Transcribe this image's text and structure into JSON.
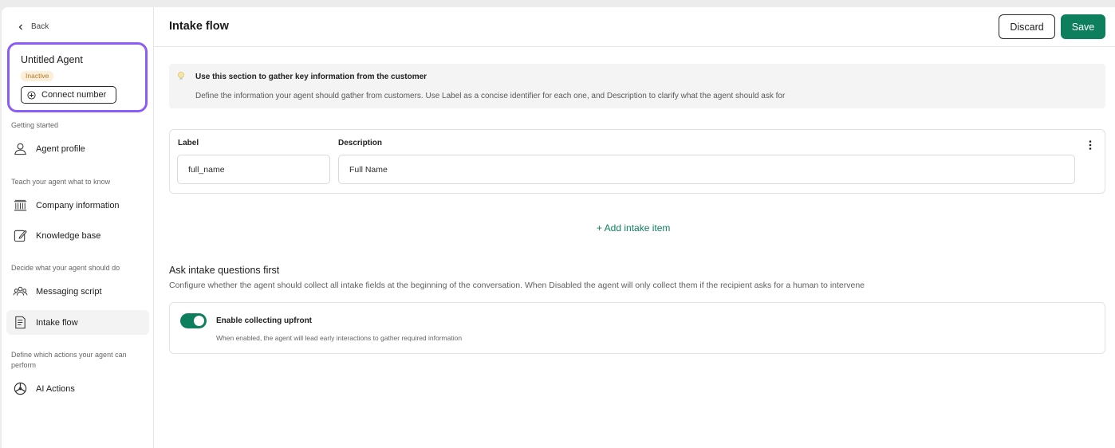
{
  "sidebar": {
    "back_label": "Back",
    "agent": {
      "name": "Untitled Agent",
      "status": "Inactive",
      "connect_label": "Connect number"
    },
    "sections": [
      {
        "heading": "Getting started"
      },
      {
        "heading": "Teach your agent what to know"
      },
      {
        "heading": "Decide what your agent should do"
      },
      {
        "heading": "Define which actions your agent can perform"
      }
    ],
    "items": [
      {
        "label": "Agent profile",
        "icon": "user-icon"
      },
      {
        "label": "Company information",
        "icon": "building-icon"
      },
      {
        "label": "Knowledge base",
        "icon": "edit-icon"
      },
      {
        "label": "Messaging script",
        "icon": "users-icon"
      },
      {
        "label": "Intake flow",
        "icon": "document-icon"
      },
      {
        "label": "AI Actions",
        "icon": "actions-icon"
      }
    ]
  },
  "header": {
    "title": "Intake flow",
    "discard_label": "Discard",
    "save_label": "Save"
  },
  "info": {
    "icon": "lightbulb-icon",
    "title": "Use this section to gather key information from the customer",
    "description": "Define the information your agent should gather from customers. Use Label as a concise identifier for each one, and Description to clarify what the agent should ask for"
  },
  "intake": {
    "label_header": "Label",
    "description_header": "Description",
    "items": [
      {
        "label": "full_name",
        "description": "Full Name"
      }
    ],
    "add_label": "+ Add intake item"
  },
  "ask_first": {
    "title": "Ask intake questions first",
    "description": "Configure whether the agent should collect all intake fields at the beginning of the conversation. When Disabled the agent will only collect them if the recipient asks for a human to intervene",
    "toggle_title": "Enable collecting upfront",
    "toggle_description": "When enabled, the agent will lead early interactions to gather required information",
    "enabled": true
  },
  "colors": {
    "accent": "#0e7f5d",
    "highlight": "#8b5cf6",
    "badge_bg": "#fbefd9",
    "badge_text": "#b07a2a"
  }
}
